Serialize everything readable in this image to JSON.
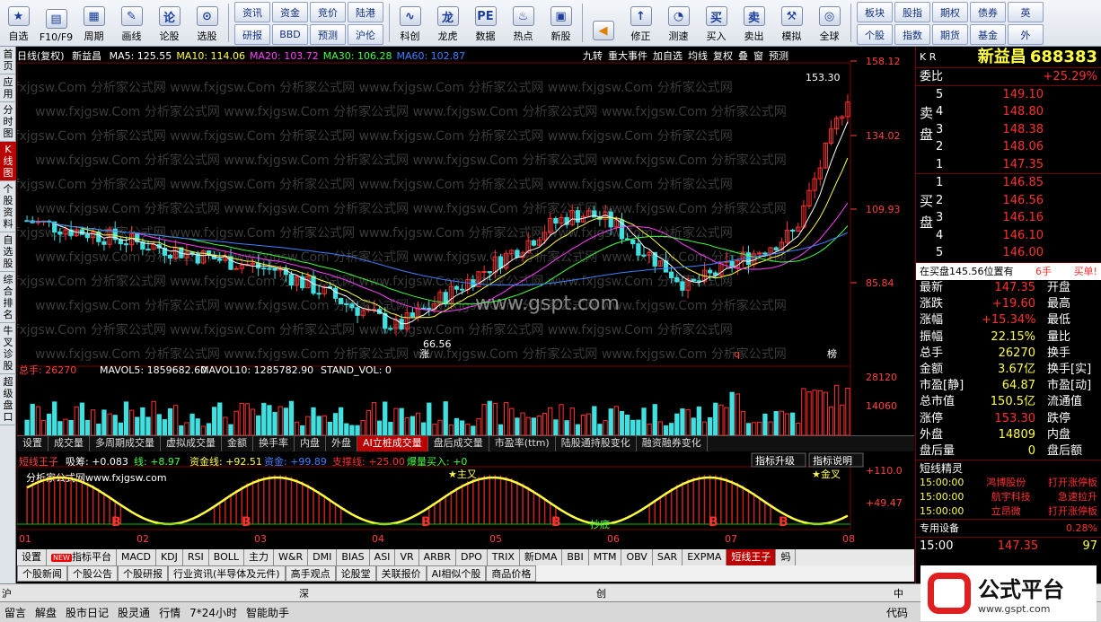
{
  "toolbar": {
    "left_buttons": [
      {
        "label": "自选",
        "icon": "star-icon"
      },
      {
        "label": "F10/F9",
        "icon": "document-icon"
      },
      {
        "label": "周期",
        "icon": "calendar-icon"
      },
      {
        "label": "画线",
        "icon": "pencil-icon"
      },
      {
        "label": "论股",
        "icon": "discuss-icon"
      },
      {
        "label": "选股",
        "icon": "stock-picker-icon"
      }
    ],
    "grid_left": [
      "资讯",
      "资金",
      "竞价",
      "陆港",
      "研报",
      "BBD",
      "预测",
      "沪伦"
    ],
    "mid_buttons": [
      {
        "label": "科创",
        "icon": "sci-tech-icon"
      },
      {
        "label": "龙虎",
        "icon": "dragon-tiger-icon"
      },
      {
        "label": "数据",
        "icon": "data-pe-icon"
      },
      {
        "label": "热点",
        "icon": "fire-icon"
      },
      {
        "label": "新股",
        "icon": "ipo-icon"
      }
    ],
    "nav_buttons": [
      {
        "label": "修正",
        "icon": "correct-icon"
      },
      {
        "label": "测速",
        "icon": "speed-test-icon"
      },
      {
        "label": "买入",
        "icon": "buy-icon"
      },
      {
        "label": "卖出",
        "icon": "sell-icon"
      },
      {
        "label": "模拟",
        "icon": "hammer-icon"
      },
      {
        "label": "全球",
        "icon": "globe-icon"
      }
    ],
    "grid_right": [
      "板块",
      "股指",
      "期权",
      "债券",
      "英",
      "个股",
      "指数",
      "期货",
      "基金",
      "外"
    ]
  },
  "leftnav": [
    {
      "label": "首页",
      "active": false
    },
    {
      "label": "应用",
      "active": false
    },
    {
      "label": "分时图",
      "active": false
    },
    {
      "label": "K线图",
      "active": true
    },
    {
      "label": "个股资料",
      "active": false
    },
    {
      "label": "自选股",
      "active": false
    },
    {
      "label": "综合排名",
      "active": false
    },
    {
      "label": "牛叉诊股",
      "active": false
    },
    {
      "label": "超级盘口",
      "active": false
    }
  ],
  "chart": {
    "period": "日线(复权)",
    "name": "新益昌",
    "ma": [
      {
        "label": "MA5: 125.55",
        "color": "#ffffff"
      },
      {
        "label": "MA10: 114.06",
        "color": "#ffff40"
      },
      {
        "label": "MA20: 103.72",
        "color": "#ff40ff"
      },
      {
        "label": "MA30: 106.28",
        "color": "#40ff40"
      },
      {
        "label": "MA60: 102.87",
        "color": "#4080ff"
      }
    ],
    "tools": [
      "九转",
      "重大事件",
      "加自选",
      "均线",
      "复权",
      "叠",
      "窗",
      "预测"
    ],
    "price_axis": [
      "158.12",
      "134.02",
      "109.93",
      "85.84"
    ],
    "high_label": "153.30",
    "low_label": "66.56",
    "marks": {
      "bottom": "涨",
      "q": "q",
      "list": "榜"
    },
    "watermark": "www.fxjgsw.Com 分析家公式网",
    "center_watermark": "www.gspt.com",
    "volume_title": "总手: 26270",
    "mavol5": "MAVOL5: 1859682.60",
    "mavol10": "MAVOL10: 1285782.90",
    "std_vol": "STAND_VOL: 0",
    "vol_axis": [
      "28120",
      "14060"
    ],
    "indicator_tabs": [
      "设置",
      "成交量",
      "多周期成交量",
      "虚拟成交量",
      "金额",
      "换手率",
      "内盘",
      "外盘",
      "AI立桩成交量",
      "盘后成交量",
      "市盈率(ttm)",
      "陆股通持股变化",
      "融资融券变化"
    ],
    "indicator_active": "AI立桩成交量",
    "ind2_title": "短线王子",
    "ind2_values": [
      {
        "label": "吸筹: +0.083",
        "color": "#ffffff"
      },
      {
        "label": "线: +8.97",
        "color": "#40ff40"
      },
      {
        "label": "资金线: +92.51",
        "color": "#ffff40"
      },
      {
        "label": "资金: +99.89",
        "color": "#4080ff"
      },
      {
        "label": "支撑线: +25.00",
        "color": "#ff3030"
      },
      {
        "label": "爆量买入: +0",
        "color": "#40ff40"
      }
    ],
    "ind2_btn1": "指标升级",
    "ind2_btn2": "指标说明",
    "ind2_watermark": "分析家公式网www.fxjgsw.com",
    "ind2_axis": [
      "+110.0",
      "+49.47"
    ],
    "ind2_labels": {
      "star": "主又",
      "star2": "金叉",
      "bottom": "抄底",
      "b": "B"
    },
    "months": [
      "01",
      "02",
      "03",
      "04",
      "05",
      "06",
      "07",
      "08"
    ],
    "bottom_tabs": [
      "设置",
      "指标平台",
      "MACD",
      "KDJ",
      "RSI",
      "BOLL",
      "主力",
      "W&R",
      "DMI",
      "BIAS",
      "ASI",
      "VR",
      "ARBR",
      "DPO",
      "TRIX",
      "新DMA",
      "BBI",
      "MTM",
      "OBV",
      "SAR",
      "EXPMA",
      "短线王子",
      "蚂"
    ],
    "bottom_active": "短线王子",
    "news_tabs": [
      "个股新闻",
      "个股公告",
      "个股研报",
      "行业资讯(半导体及元件)",
      "高手观点",
      "论股堂",
      "关联报价",
      "AI相似个股",
      "商品价格"
    ]
  },
  "right": {
    "code_prefix": "K R",
    "name": "新益昌",
    "code": "688383",
    "weibi_label": "委比",
    "weibi": "+25.29%",
    "sell_label": "卖盘",
    "sell": [
      {
        "level": "5",
        "price": "149.10"
      },
      {
        "level": "4",
        "price": "148.80"
      },
      {
        "level": "3",
        "price": "148.38"
      },
      {
        "level": "2",
        "price": "148.06"
      },
      {
        "level": "1",
        "price": "147.35"
      }
    ],
    "buy_label": "买盘",
    "buy": [
      {
        "level": "1",
        "price": "146.85"
      },
      {
        "level": "2",
        "price": "146.56"
      },
      {
        "level": "3",
        "price": "146.16"
      },
      {
        "level": "4",
        "price": "146.10"
      },
      {
        "level": "5",
        "price": "146.00"
      }
    ],
    "buy_bar": {
      "text": "在买盘145.56位置有",
      "hands": "6手",
      "action": "买单!"
    },
    "stats": [
      {
        "k1": "最新",
        "v1": "147.35",
        "k2": "开盘",
        "v2": ""
      },
      {
        "k1": "涨跌",
        "v1": "+19.60",
        "k2": "最高",
        "v2": ""
      },
      {
        "k1": "涨幅",
        "v1": "+15.34%",
        "k2": "最低",
        "v2": ""
      },
      {
        "k1": "振幅",
        "v1": "22.15%",
        "k2": "量比",
        "v2": ""
      },
      {
        "k1": "总手",
        "v1": "26270",
        "k2": "换手",
        "v2": ""
      },
      {
        "k1": "金额",
        "v1": "3.67亿",
        "k2": "换手[实]",
        "v2": ""
      },
      {
        "k1": "市盈[静]",
        "v1": "64.87",
        "k2": "市盈[动]",
        "v2": ""
      },
      {
        "k1": "总市值",
        "v1": "150.5亿",
        "k2": "流通值",
        "v2": ""
      },
      {
        "k1": "涨停",
        "v1": "153.30",
        "k2": "跌停",
        "v2": ""
      },
      {
        "k1": "外盘",
        "v1": "14809",
        "k2": "内盘",
        "v2": ""
      },
      {
        "k1": "盘后量",
        "v1": "0",
        "k2": "盘后额",
        "v2": ""
      }
    ],
    "sprite_title": "短线精灵",
    "sprite": [
      {
        "time": "15:00:00",
        "name": "鸿博股份",
        "event": "打开涨停板"
      },
      {
        "time": "15:00:00",
        "name": "航宇科技",
        "event": "急速拉升"
      },
      {
        "time": "15:00:00",
        "name": "立昂微",
        "event": "打开涨停板"
      }
    ],
    "device_label": "专用设备",
    "device_value": "0.28%",
    "tick_time": "15:00",
    "tick_price": "147.35",
    "tick_vol": "97"
  },
  "status": {
    "sh": "沪",
    "sz": "深",
    "cy": "创",
    "zh": "中"
  },
  "funcbar": [
    "留言",
    "解盘",
    "股市日记",
    "股灵通",
    "行情",
    "7*24小时",
    "智能助手"
  ],
  "funcbar_right": "代码",
  "logo": {
    "text": "公式平台",
    "url": "www.gspt.com"
  }
}
